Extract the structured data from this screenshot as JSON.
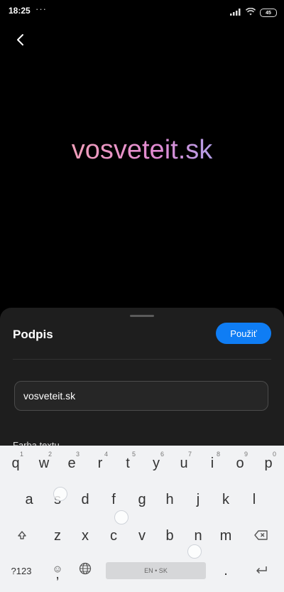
{
  "status_bar": {
    "time": "18:25",
    "dots": "···",
    "battery": "45"
  },
  "preview": {
    "signature_text": "vosveteit.sk"
  },
  "sheet": {
    "title": "Podpis",
    "apply_label": "Použiť",
    "input_value": "vosveteit.sk",
    "section_label": "Farba textu"
  },
  "keyboard": {
    "row1": [
      "q",
      "w",
      "e",
      "r",
      "t",
      "y",
      "u",
      "i",
      "o",
      "p"
    ],
    "row1_hints": [
      "1",
      "2",
      "3",
      "4",
      "5",
      "6",
      "7",
      "8",
      "9",
      "0"
    ],
    "row2": [
      "a",
      "s",
      "d",
      "f",
      "g",
      "h",
      "j",
      "k",
      "l"
    ],
    "row3": [
      "z",
      "x",
      "c",
      "v",
      "b",
      "n",
      "m"
    ],
    "symbols_key": "?123",
    "comma_key": ",",
    "period_key": ".",
    "space_label": "EN • SK"
  },
  "icons": {
    "back": "back-arrow-icon",
    "signal": "signal-icon",
    "wifi": "wifi-icon",
    "battery": "battery-icon",
    "shift": "shift-icon",
    "backspace": "backspace-icon",
    "globe": "globe-icon",
    "emoji": "emoji-icon",
    "enter": "enter-icon"
  }
}
